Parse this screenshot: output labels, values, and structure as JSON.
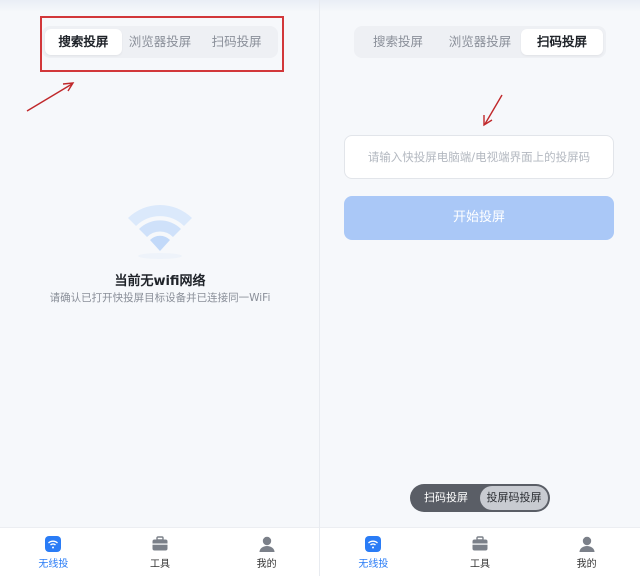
{
  "left": {
    "tabs": [
      {
        "label": "搜索投屏",
        "active": true
      },
      {
        "label": "浏览器投屏",
        "active": false
      },
      {
        "label": "扫码投屏",
        "active": false
      }
    ],
    "no_wifi_title": "当前无wifi网络",
    "no_wifi_desc": "请确认已打开快投屏目标设备并已连接同一WiFi"
  },
  "right": {
    "tabs": [
      {
        "label": "搜索投屏",
        "active": false
      },
      {
        "label": "浏览器投屏",
        "active": false
      },
      {
        "label": "扫码投屏",
        "active": true
      }
    ],
    "code_input_placeholder": "请输入快投屏电脑端/电视端界面上的投屏码",
    "start_button": "开始投屏",
    "mode_toggle": [
      {
        "label": "扫码投屏",
        "active": false
      },
      {
        "label": "投屏码投屏",
        "active": true
      }
    ]
  },
  "bottom_nav": [
    {
      "label": "无线投",
      "icon": "cast-wifi-icon",
      "active": true
    },
    {
      "label": "工具",
      "icon": "toolbox-icon",
      "active": false
    },
    {
      "label": "我的",
      "icon": "user-icon",
      "active": false
    }
  ],
  "colors": {
    "accent": "#2a7cf6",
    "button_disabled": "#aac8f7",
    "annotation": "#d2373a"
  }
}
